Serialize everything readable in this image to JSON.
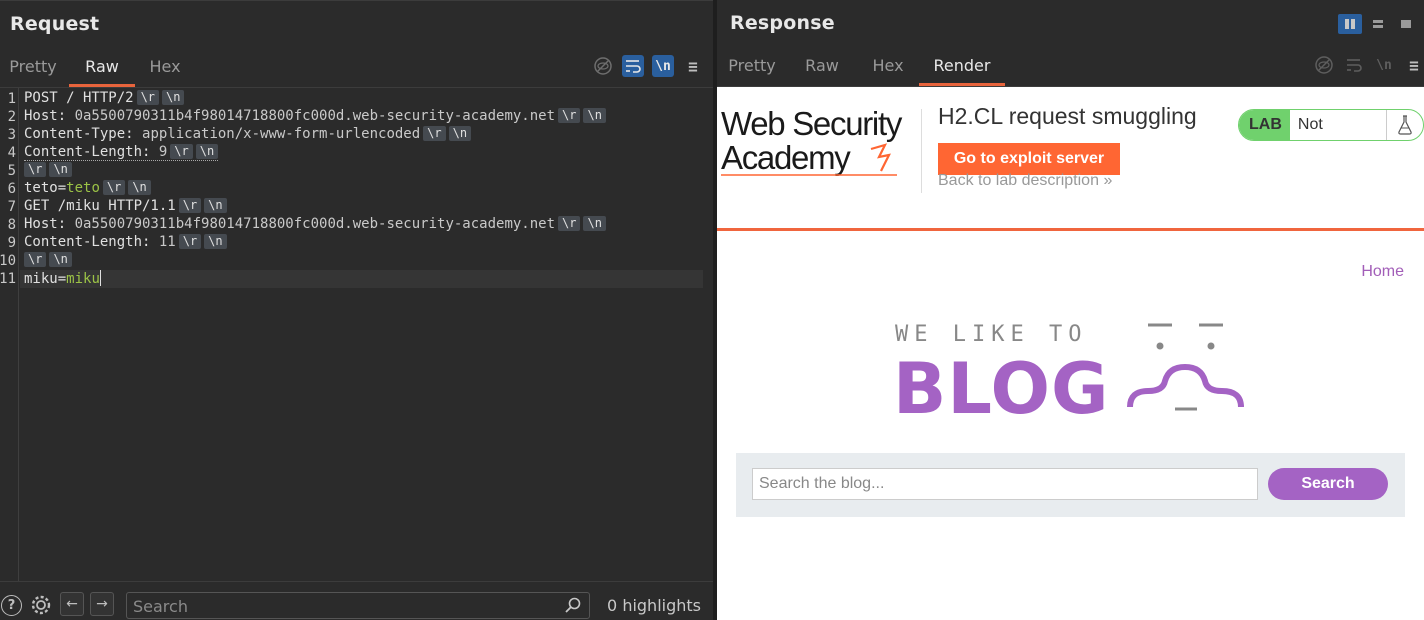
{
  "request": {
    "title": "Request",
    "tabs": [
      "Pretty",
      "Raw",
      "Hex"
    ],
    "active_tab": "Raw",
    "tools": [
      "hide-nonprinting-icon",
      "wrap-lines-icon",
      "show-newlines-icon",
      "menu-icon"
    ],
    "tools_glyph_newline": "\\n",
    "newline_marker_r": "\\r",
    "newline_marker_n": "\\n",
    "lines": [
      {
        "num": "1",
        "key": "POST / HTTP/2",
        "val": ""
      },
      {
        "num": "2",
        "key": "Host: ",
        "val": "0a5500790311b4f98014718800fc000d.web-security-academy.net"
      },
      {
        "num": "3",
        "key": "Content-Type: ",
        "val": "application/x-www-form-urlencoded"
      },
      {
        "num": "4",
        "key": "Content-Length: ",
        "val": "9"
      },
      {
        "num": "5",
        "key": "",
        "val": ""
      },
      {
        "num": "6",
        "key": "teto=",
        "val": "teto"
      },
      {
        "num": "7",
        "key": "GET /miku HTTP/1.1",
        "val": ""
      },
      {
        "num": "8",
        "key": "Host: ",
        "val": "0a5500790311b4f98014718800fc000d.web-security-academy.net"
      },
      {
        "num": "9",
        "key": "Content-Length: ",
        "val": "11"
      },
      {
        "num": "10",
        "key": "",
        "val": ""
      },
      {
        "num": "11",
        "key": "miku=",
        "val": "miku"
      }
    ],
    "search_placeholder": "Search",
    "highlights": "0 highlights"
  },
  "response": {
    "title": "Response",
    "tabs": [
      "Pretty",
      "Raw",
      "Hex",
      "Render"
    ],
    "active_tab": "Render",
    "render": {
      "logo_line1": "Web Security",
      "logo_line2": "Academy",
      "lab_title": "H2.CL request smuggling",
      "exploit_button": "Go to exploit server",
      "back_link": "Back to lab description",
      "back_chevron": "»",
      "lab_label": "LAB",
      "lab_status": "Not solved",
      "home_link": "Home",
      "blog_tagline": "WE LIKE TO",
      "blog_word": "BLOG",
      "search_placeholder": "Search the blog...",
      "search_button": "Search"
    }
  },
  "colors": {
    "accent_orange": "#e8643c",
    "toggle_blue": "#2a5f9e",
    "value_green": "#9bc246",
    "lab_green": "#70d16d",
    "blog_purple": "#a463c4",
    "portswigger_orange": "#ff6633"
  }
}
